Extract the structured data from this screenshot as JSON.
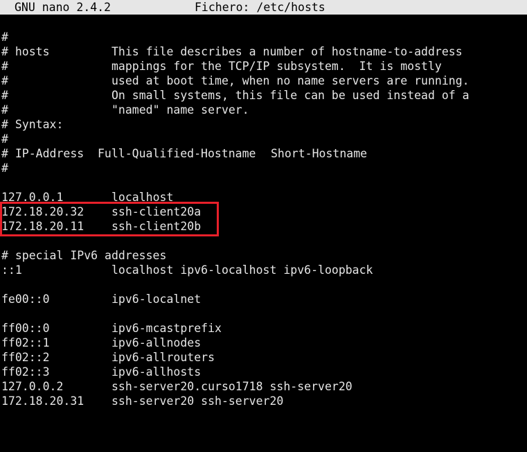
{
  "titlebar": {
    "app": "GNU nano 2.4.2",
    "file": "Fichero: /etc/hosts"
  },
  "header_comments": [
    {
      "hash": "#",
      "a": "",
      "b": ""
    },
    {
      "hash": "# hosts",
      "a": "This file describes a number of hostname-to-address",
      "b": ""
    },
    {
      "hash": "#",
      "a": "mappings for the TCP/IP subsystem.  It is mostly",
      "b": ""
    },
    {
      "hash": "#",
      "a": "used at boot time, when no name servers are running.",
      "b": ""
    },
    {
      "hash": "#",
      "a": "On small systems, this file can be used instead of a",
      "b": ""
    },
    {
      "hash": "#",
      "a": "\"named\" name server.",
      "b": ""
    }
  ],
  "syntax": {
    "line1": "# Syntax:",
    "line2": "#",
    "col_hash": "# IP-Address",
    "col_fqhn": "Full-Qualified-Hostname",
    "col_short": "Short-Hostname",
    "line4": "#"
  },
  "entries_v4": [
    {
      "ip": "127.0.0.1",
      "host": "localhost"
    },
    {
      "ip": "172.18.20.32",
      "host": "ssh-client20a"
    },
    {
      "ip": "172.18.20.11",
      "host": "ssh-client20b"
    }
  ],
  "ipv6_comment": "# special IPv6 addresses",
  "entries_v6a": [
    {
      "ip": "::1",
      "host": "localhost ipv6-localhost ipv6-loopback"
    }
  ],
  "entries_v6b": [
    {
      "ip": "fe00::0",
      "host": "ipv6-localnet"
    }
  ],
  "entries_v6c": [
    {
      "ip": "ff00::0",
      "host": "ipv6-mcastprefix"
    },
    {
      "ip": "ff02::1",
      "host": "ipv6-allnodes"
    },
    {
      "ip": "ff02::2",
      "host": "ipv6-allrouters"
    },
    {
      "ip": "ff02::3",
      "host": "ipv6-allhosts"
    },
    {
      "ip": "127.0.0.2",
      "host": "ssh-server20.curso1718 ssh-server20"
    },
    {
      "ip": "172.18.20.31",
      "host": "ssh-server20 ssh-server20"
    }
  ],
  "colors": {
    "background": "#000000",
    "text": "#e6e6e6",
    "titlebar_bg": "#e6e6e6",
    "highlight": "#e8202a"
  }
}
